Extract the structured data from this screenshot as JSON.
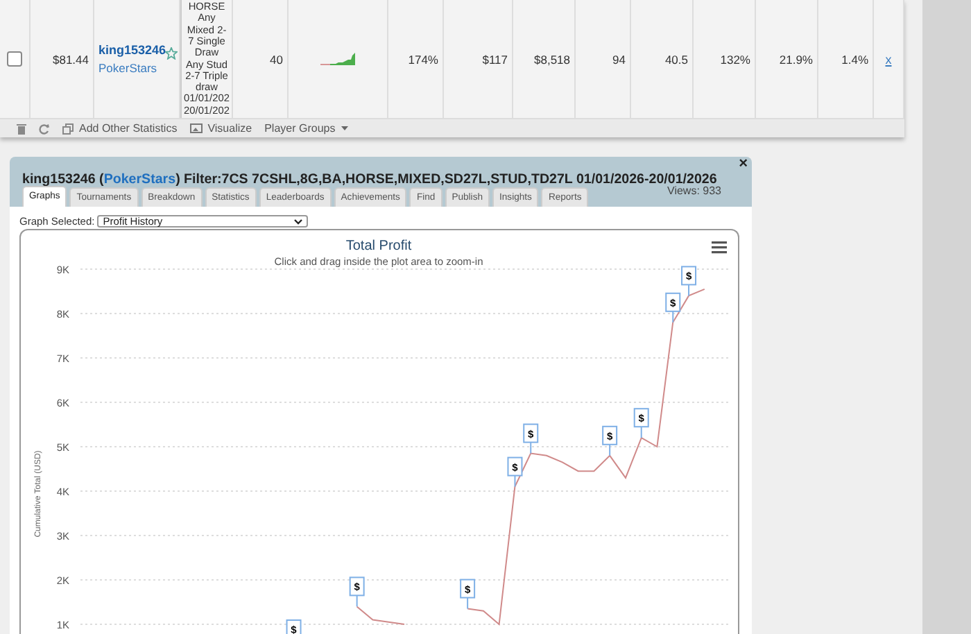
{
  "table": {
    "rows": [
      {
        "checked": false,
        "column_2": "$81.44",
        "player": "king153246",
        "site": "PokerStars",
        "favorite": false,
        "column_4": "HORSE\nAny\nMixed 2-\n7 Single\nDraw\nAny Stud\n2-7 Triple\ndraw\n01/01/202\n20/01/202",
        "column_5": "40",
        "values": [
          "174%",
          "$117",
          "$8,518",
          "94",
          "40.5",
          "132%",
          "21.9%",
          "1.4%"
        ],
        "remove": "x"
      }
    ]
  },
  "toolbar": [
    {
      "kind": "delete"
    },
    {
      "kind": "refresh"
    },
    {
      "kind": "add",
      "label": "Add Other Statistics"
    },
    {
      "kind": "visualize",
      "label": "Visualize"
    },
    {
      "kind": "menu",
      "label": "Player Groups"
    }
  ],
  "panel": {
    "title_prefix": "king153246 (",
    "site": "PokerStars",
    "title_suffix": ") Filter:7CS 7CSHL,8G,BA,HORSE,MIXED,SD27L,STUD,TD27L 01/01/2026-20/01/2026",
    "views": "Views: 933",
    "close": "×",
    "tabs": [
      {
        "label": "Graphs",
        "selected": true
      },
      {
        "label": "Tournaments",
        "selected": false
      },
      {
        "label": "Breakdown",
        "selected": false
      },
      {
        "label": "Statistics",
        "selected": false
      },
      {
        "label": "Leaderboards",
        "selected": false
      },
      {
        "label": "Achievements",
        "selected": false
      },
      {
        "label": "Find",
        "selected": false
      },
      {
        "label": "Publish",
        "selected": false
      },
      {
        "label": "Insights",
        "selected": false
      },
      {
        "label": "Reports",
        "selected": false
      }
    ],
    "graph_label": "Graph Selected:",
    "graph_value": "Profit History",
    "chart_data": {
      "type": "line",
      "title": "Total Profit",
      "subtitle": "Click and drag inside the plot area to zoom-in",
      "ylabel": "Cumulative Total (USD)",
      "categories": [
        null,
        null,
        null,
        null,
        null,
        null,
        null,
        null,
        null,
        null,
        null,
        null,
        null,
        null,
        null,
        null,
        null,
        null,
        null,
        null,
        null,
        null,
        null,
        null,
        null,
        null,
        null,
        null,
        null,
        null,
        null,
        null,
        null,
        null,
        null,
        null,
        null,
        null,
        null,
        null,
        null
      ],
      "series": [
        {
          "color": "#d08a8a",
          "values": [
            null,
            null,
            null,
            null,
            null,
            null,
            null,
            null,
            null,
            null,
            null,
            null,
            null,
            null,
            null,
            null,
            null,
            1400,
            1100,
            1050,
            1000,
            null,
            null,
            null,
            1350,
            1300,
            1000,
            4100,
            4850,
            4800,
            4650,
            4450,
            4450,
            4800,
            4300,
            5200,
            5000,
            7800,
            8400,
            8550,
            null
          ]
        }
      ],
      "ylim": [
        1000,
        9000
      ],
      "grid": true,
      "yticks": [
        {
          "value": 1000,
          "label": "1K"
        },
        {
          "value": 2000,
          "label": "2K"
        },
        {
          "value": 3000,
          "label": "3K"
        },
        {
          "value": 4000,
          "label": "4K"
        },
        {
          "value": 5000,
          "label": "5K"
        },
        {
          "value": 6000,
          "label": "6K"
        },
        {
          "value": 7000,
          "label": "7K"
        },
        {
          "value": 8000,
          "label": "8K"
        },
        {
          "value": 9000,
          "label": "9K"
        }
      ],
      "annotations": [
        "$",
        "$",
        "$",
        "$",
        "$",
        "$",
        "$",
        "$",
        "$"
      ]
    }
  }
}
